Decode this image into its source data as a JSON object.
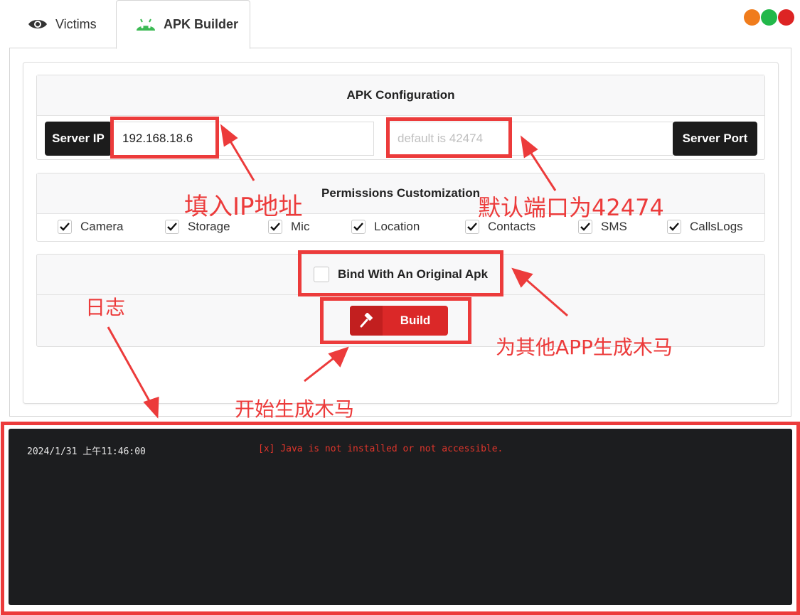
{
  "tabs": [
    {
      "label": "Victims",
      "icon": "eye-icon"
    },
    {
      "label": "APK Builder",
      "icon": "android-icon"
    }
  ],
  "window_controls": {
    "colors": [
      "#f07c1c",
      "#22b84a",
      "#dd2424"
    ]
  },
  "config": {
    "title": "APK Configuration",
    "server_ip_label": "Server IP",
    "server_ip_value": "192.168.18.6",
    "server_port_label": "Server Port",
    "server_port_placeholder": "default is 42474"
  },
  "permissions": {
    "title": "Permissions Customization",
    "items": [
      {
        "label": "Camera",
        "checked": true
      },
      {
        "label": "Storage",
        "checked": true
      },
      {
        "label": "Mic",
        "checked": true
      },
      {
        "label": "Location",
        "checked": true
      },
      {
        "label": "Contacts",
        "checked": true
      },
      {
        "label": "SMS",
        "checked": true
      },
      {
        "label": "CallsLogs",
        "checked": true
      }
    ]
  },
  "bind": {
    "label": "Bind With An Original Apk",
    "checked": false
  },
  "build": {
    "label": "Build",
    "icon": "hammer-icon"
  },
  "log": {
    "time": "2024/1/31 上午11:46:00",
    "message": "[x] Java is not installed or not accessible."
  },
  "annotations": {
    "fill_ip": "填入IP地址",
    "default_port": "默认端口为42474",
    "log": "日志",
    "trojan_other_app": "为其他APP生成木马",
    "start_build": "开始生成木马",
    "color": "#ec3b3b"
  }
}
